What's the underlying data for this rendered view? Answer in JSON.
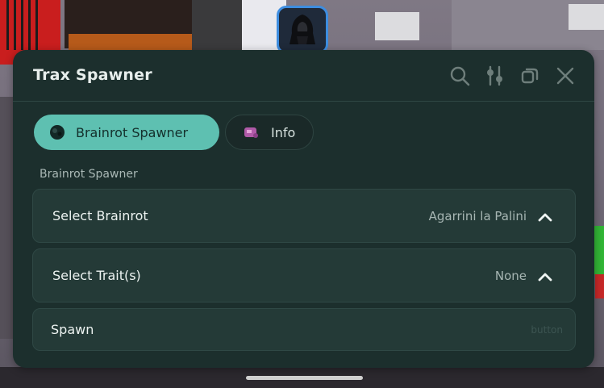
{
  "window": {
    "title": "Trax Spawner"
  },
  "toolbar": {
    "icons": [
      "search-icon",
      "sliders-icon",
      "copy-icon",
      "close-icon"
    ]
  },
  "tabs": [
    {
      "label": "Brainrot Spawner",
      "icon": "brainrot-icon",
      "active": true
    },
    {
      "label": "Info",
      "icon": "info-image-icon",
      "active": false
    }
  ],
  "section": {
    "label": "Brainrot Spawner"
  },
  "controls": {
    "select_brainrot": {
      "label": "Select Brainrot",
      "value": "Agarrini la Palini",
      "expanded": true
    },
    "select_traits": {
      "label": "Select Trait(s)",
      "value": "None",
      "expanded": true
    },
    "spawn": {
      "label": "Spawn",
      "hint": "button"
    }
  },
  "colors": {
    "accent": "#5ec0b1",
    "panel": "#1c2f2d",
    "row": "#243a37",
    "avatar_border": "#3d8de0"
  }
}
